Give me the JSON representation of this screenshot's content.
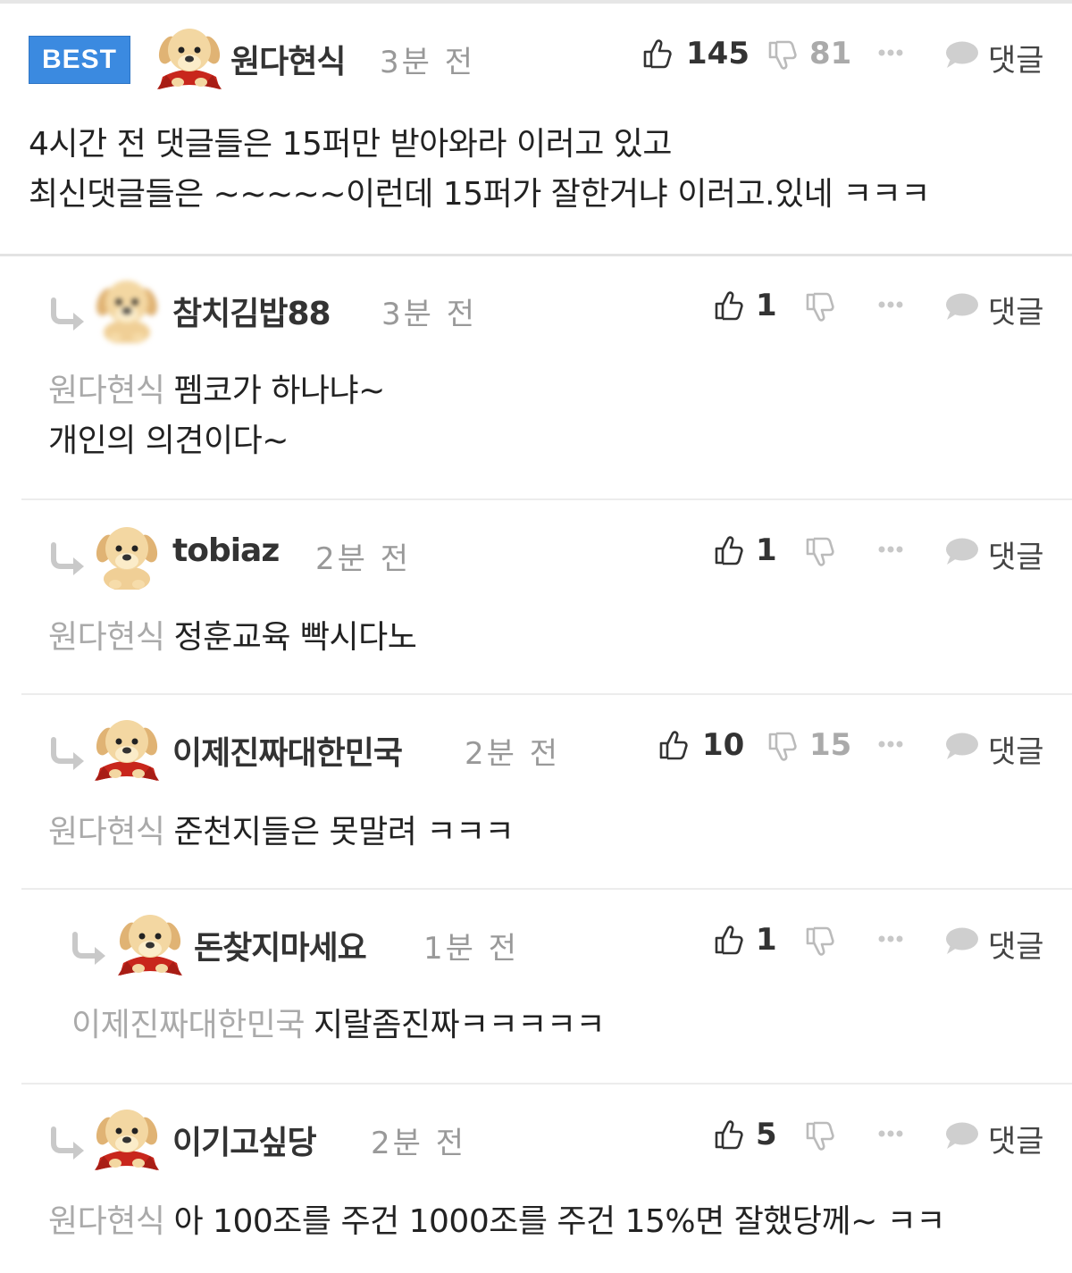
{
  "comments": [
    {
      "best_label": "BEST",
      "nickname": "원다현식",
      "time": "3분 전",
      "likes": "145",
      "dislikes": "81",
      "reply_label": "댓글",
      "body_line1": "4시간 전 댓글들은 15퍼만 받아와라 이러고 있고",
      "body_line2": "최신댓글들은 ~~~~~이런데 15퍼가 잘한거냐 이러고.있네 ㅋㅋㅋ"
    },
    {
      "nickname": "참치김밥88",
      "time": "3분 전",
      "likes": "1",
      "reply_label": "댓글",
      "mention": "원다현식",
      "body_line1": "펨코가 하나냐~",
      "body_line2": "개인의 의견이다~"
    },
    {
      "nickname": "tobiaz",
      "time": "2분 전",
      "likes": "1",
      "reply_label": "댓글",
      "mention": "원다현식",
      "body_line1": "정훈교육 빡시다노"
    },
    {
      "nickname": "이제진짜대한민국",
      "time": "2분 전",
      "likes": "10",
      "dislikes": "15",
      "reply_label": "댓글",
      "mention": "원다현식",
      "body_line1": "준천지들은 못말려 ㅋㅋㅋ"
    },
    {
      "nickname": "돈찾지마세요",
      "time": "1분 전",
      "likes": "1",
      "reply_label": "댓글",
      "mention": "이제진짜대한민국",
      "body_line1": "지랄좀진짜ㅋㅋㅋㅋㅋ"
    },
    {
      "nickname": "이기고싶당",
      "time": "2분 전",
      "likes": "5",
      "reply_label": "댓글",
      "mention": "원다현식",
      "body_line1": "아 100조를 주건 1000조를 주건 15%면 잘했당께~ ㅋㅋ"
    }
  ],
  "icons": {
    "like": "thumbs-up-icon",
    "dislike": "thumbs-down-icon",
    "more": "more-dots-icon",
    "reply": "speech-bubble-icon",
    "reply_arrow": "reply-arrow-icon",
    "avatar": "puppy-avatar"
  },
  "colors": {
    "best_badge": "#3b8ae0",
    "muted_text": "#aaaaaa",
    "divider": "#ececec"
  }
}
